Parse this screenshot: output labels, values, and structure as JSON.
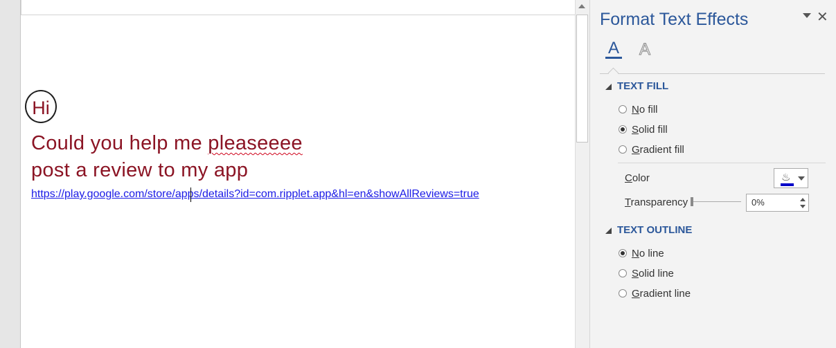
{
  "document": {
    "greeting": "Hi",
    "line1_before": "Could you help me ",
    "line1_misspelled": "pleaseeee",
    "line2": "post a review to my app",
    "link": "https://play.google.com/store/apps/details?id=com.ripplet.app&hl=en&showAllReviews=true",
    "text_color": "#8b1424",
    "link_color": "#1a1ae6"
  },
  "pane": {
    "title": "Format Text Effects",
    "close_glyph": "✕",
    "tabs": [
      {
        "glyph": "A",
        "icon": "text-fill-outline-icon",
        "active": true
      },
      {
        "glyph": "A",
        "icon": "text-effects-icon",
        "active": false
      }
    ],
    "text_fill": {
      "heading": "TEXT FILL",
      "options": [
        {
          "acc": "N",
          "rest": "o fill",
          "selected": false
        },
        {
          "acc": "S",
          "rest": "olid fill",
          "selected": true
        },
        {
          "acc": "G",
          "rest": "radient fill",
          "selected": false
        }
      ],
      "color_label_acc": "C",
      "color_label_rest": "olor",
      "color_value": "#0000c8",
      "transparency_label_acc": "T",
      "transparency_label_rest": "ransparency",
      "transparency_value": "0%"
    },
    "text_outline": {
      "heading": "TEXT OUTLINE",
      "options": [
        {
          "acc": "N",
          "rest": "o line",
          "selected": true
        },
        {
          "acc": "S",
          "rest": "olid line",
          "selected": false
        },
        {
          "acc": "G",
          "rest": "radient line",
          "selected": false
        }
      ]
    },
    "accent_color": "#2b579a"
  }
}
